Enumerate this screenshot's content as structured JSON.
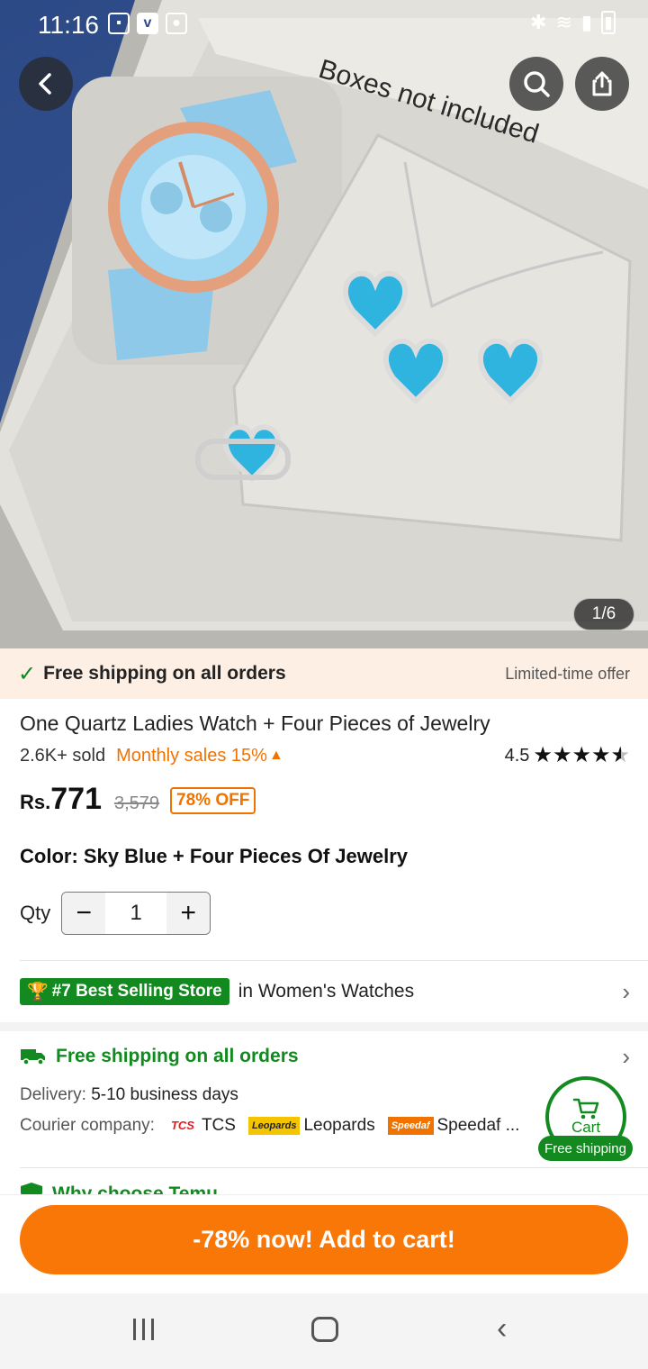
{
  "status_bar": {
    "time": "11:16",
    "icons": [
      "gallery-icon",
      "v-app-icon",
      "camera-icon",
      "bluetooth-icon",
      "wifi-icon",
      "signal-icon",
      "battery-icon"
    ]
  },
  "gallery": {
    "image_caption": "Boxes not included",
    "counter": "1/6"
  },
  "promo": {
    "text": "Free shipping on all orders",
    "offer": "Limited-time offer"
  },
  "product": {
    "title": "One Quartz Ladies Watch + Four Pieces of Jewelry",
    "sold": "2.6K+ sold",
    "monthly_sales": "Monthly sales 15%",
    "rating": "4.5",
    "rating_value": 4.5,
    "currency": "Rs.",
    "price": "771",
    "original_price": "3,579",
    "discount": "78% OFF",
    "color_label": "Color: Sky Blue + Four Pieces Of Jewelry"
  },
  "quantity": {
    "label": "Qty",
    "value": "1",
    "minus": "−",
    "plus": "+"
  },
  "best_selling": {
    "badge": "#7 Best Selling Store",
    "category": "in Women's Watches"
  },
  "shipping": {
    "title": "Free shipping on all orders",
    "delivery_label": "Delivery:",
    "delivery_value": "5-10 business days",
    "courier_label": "Courier company:",
    "couriers": [
      {
        "logo": "TCS",
        "name": "TCS"
      },
      {
        "logo": "Leopards",
        "name": "Leopards"
      },
      {
        "logo": "Speedaf",
        "name": "Speedaf ..."
      }
    ]
  },
  "why_choose": "Why choose Temu",
  "cart_fab": {
    "label": "Cart",
    "badge": "Free shipping"
  },
  "cta": {
    "label": "-78% now! Add to cart!"
  },
  "colors": {
    "accent_orange": "#f97706",
    "green": "#128a1f",
    "promo_bg": "#fdefe4"
  }
}
